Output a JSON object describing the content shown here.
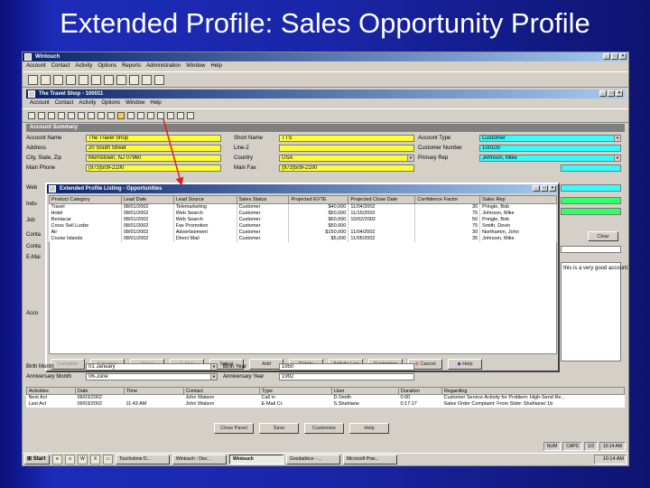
{
  "slide": {
    "title": "Extended Profile: Sales Opportunity Profile"
  },
  "app": {
    "title": "Wintouch",
    "menu": [
      "Account",
      "Contact",
      "Activity",
      "Options",
      "Reports",
      "Administration",
      "Window",
      "Help"
    ]
  },
  "doc": {
    "title": "The Travel Shop - 100011",
    "menu": [
      "Account",
      "Contact",
      "Activity",
      "Options",
      "Window",
      "Help"
    ]
  },
  "account_summary": {
    "header": "Account Summary",
    "labels": {
      "account_name": "Account Name",
      "address": "Address",
      "city_state_zip": "City, State, Zip",
      "main_phone": "Main Phone",
      "short_name": "Short Name",
      "line2": "Line-2",
      "country": "Country",
      "main_fax": "Main Fax",
      "account_type": "Account Type",
      "customer_number": "Customer Number",
      "primary_rep": "Primary Rep"
    },
    "values": {
      "account_name": "The Travel Shop",
      "address": "20 South Street",
      "city_state_zip": "Morristown, NJ 07960",
      "main_phone": "(973)509-2100",
      "short_name": "TTS",
      "line2": "",
      "country": "USA",
      "main_fax": "(973)509-2100",
      "account_type": "Customer",
      "customer_number": "100100",
      "primary_rep": "Johnson, Mike"
    },
    "side_labels": [
      "Web",
      "Indu",
      "Job",
      "Conta",
      "Conta",
      "E-Mai",
      "Acco"
    ],
    "clear_button": "Clear",
    "notes_text": "this is a very good account."
  },
  "dialog": {
    "title": "Extended Profile Listing - Opportunities",
    "columns": [
      "Product Category",
      "Lead Date",
      "Lead Source",
      "Sales Status",
      "Projected EVTE",
      "Projected Close Date",
      "Confidence Factor",
      "Sales Rep"
    ],
    "rows": [
      [
        "Travel",
        "08/01/2002",
        "Telemarketing",
        "Customer",
        "$40,000",
        "11/04/2002",
        "30",
        "Pringle, Bob"
      ],
      [
        "Hotel",
        "08/01/2002",
        "Web Search",
        "Customer",
        "$50,000",
        "11/15/2002",
        "75",
        "Johnson, Mike"
      ],
      [
        "Rentacar",
        "08/01/2002",
        "Web Search",
        "Customer",
        "$60,000",
        "10/02/2002",
        "50",
        "Pringle, Bob"
      ],
      [
        "Cross Sell Luxbe",
        "08/01/2002",
        "Fax Promotion",
        "Customer",
        "$50,000",
        "",
        "75",
        "Smith, Devin"
      ],
      [
        "Air",
        "08/01/2002",
        "Advertisement",
        "Customer",
        "$150,000",
        "11/04/2002",
        "30",
        "Northamm, John"
      ],
      [
        "Cruise Islands",
        "08/01/2002",
        "Direct Mail",
        "Customer",
        "$5,000",
        "11/05/2002",
        "35",
        "Johnson, Mike"
      ]
    ],
    "buttons": {
      "complete": "Complete",
      "reschedule": "Schedule",
      "word": "Word",
      "email": "E-Mail",
      "select": "Select",
      "add": "Add",
      "delete": "Delete",
      "activity_log": "Activity Log",
      "customize": "Customize",
      "cancel": "Cancel",
      "help": "Help"
    }
  },
  "extra_fields": {
    "birth_month_label": "Birth Month",
    "birth_month": "01 January",
    "anniversary_month_label": "Anniversary Month",
    "anniversary_month": "06-June",
    "birth_year_label": "Birth Year",
    "birth_year": "1950",
    "anniversary_year_label": "Anniversary Year",
    "anniversary_year": "1992"
  },
  "activities": {
    "columns": [
      "Activities",
      "Date",
      "Time",
      "Contact",
      "Type",
      "User",
      "Duration",
      "Regarding"
    ],
    "rows": [
      [
        "Next Act",
        "09/03/2002",
        "",
        "John Watson",
        "Call in",
        "D.Smith",
        "0:00",
        "Customer Service Activity for Problem: High-Send Re..."
      ],
      [
        "Last Act",
        "09/03/2002",
        "11:43 AM",
        "John Watson",
        "E-Mail Cr.",
        "S.Shahlane",
        "0:17:17",
        "Sales Order Complaint: From Slide: Shahlane/ 1b"
      ]
    ],
    "buttons": [
      "Close Panel",
      "Save",
      "Customize",
      "Help"
    ]
  },
  "statusbar": [
    "NUM",
    "CAPS",
    "1/3",
    "10:14 AM"
  ],
  "taskbar": {
    "start": "Start",
    "tasks": [
      "Touchstone D...",
      "Wintouch - Dev...",
      "Wintouch",
      "Goodadvice - ...",
      "Microsoft Pow..."
    ],
    "clock": "10:14 AM"
  },
  "accent": {
    "yellow": "#ffff33",
    "cyan": "#33ffff",
    "arrow": "#e02020"
  }
}
